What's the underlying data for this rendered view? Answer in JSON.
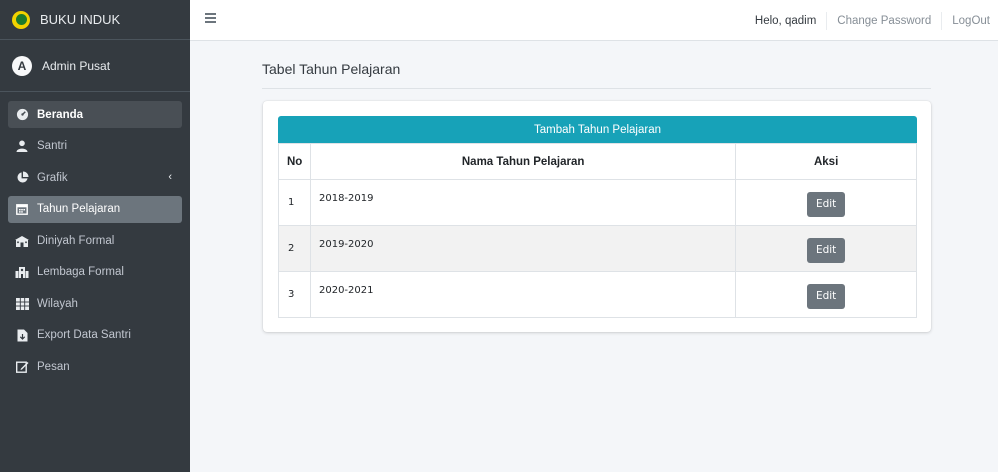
{
  "brand": {
    "name": "BUKU INDUK"
  },
  "user": {
    "name": "Admin Pusat"
  },
  "sidebar": {
    "items": [
      {
        "label": "Beranda",
        "icon": "tachometer-icon"
      },
      {
        "label": "Santri",
        "icon": "user-icon"
      },
      {
        "label": "Grafik",
        "icon": "pie-chart-icon"
      },
      {
        "label": "Tahun Pelajaran",
        "icon": "calendar-icon"
      },
      {
        "label": "Diniyah Formal",
        "icon": "school-icon"
      },
      {
        "label": "Lembaga Formal",
        "icon": "building-icon"
      },
      {
        "label": "Wilayah",
        "icon": "grid-icon"
      },
      {
        "label": "Export Data Santri",
        "icon": "file-export-icon"
      },
      {
        "label": "Pesan",
        "icon": "edit-icon"
      }
    ],
    "chevron": "‹"
  },
  "topbar": {
    "greeting": "Helo, qadim",
    "change_password": "Change Password",
    "logout": "LogOut"
  },
  "page": {
    "title": "Tabel Tahun Pelajaran"
  },
  "card": {
    "add_label": "Tambah Tahun Pelajaran",
    "columns": {
      "no": "No",
      "name": "Nama Tahun Pelajaran",
      "aksi": "Aksi"
    },
    "rows": [
      {
        "no": "1",
        "name": "2018-2019",
        "action": "Edit"
      },
      {
        "no": "2",
        "name": "2019-2020",
        "action": "Edit"
      },
      {
        "no": "3",
        "name": "2020-2021",
        "action": "Edit"
      }
    ]
  },
  "colors": {
    "sidebar_bg": "#343a40",
    "accent": "#17a2b8",
    "button": "#6c757d"
  }
}
